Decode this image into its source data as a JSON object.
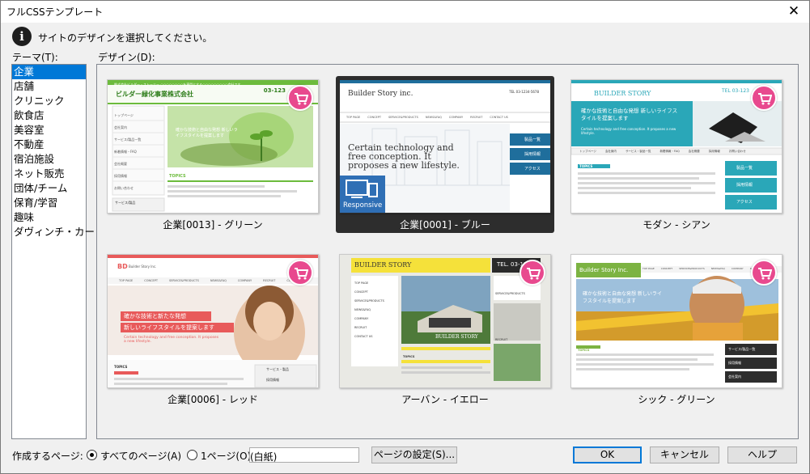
{
  "window": {
    "title": "フルCSSテンプレート"
  },
  "info": {
    "message": "サイトのデザインを選択してください。"
  },
  "labels": {
    "theme": "テーマ(T):",
    "design": "デザイン(D):"
  },
  "themes": [
    {
      "label": "企業",
      "selected": true
    },
    {
      "label": "店舗"
    },
    {
      "label": "クリニック"
    },
    {
      "label": "飲食店"
    },
    {
      "label": "美容室"
    },
    {
      "label": "不動産"
    },
    {
      "label": "宿泊施設"
    },
    {
      "label": "ネット販売"
    },
    {
      "label": "団体/チーム"
    },
    {
      "label": "保育/学習"
    },
    {
      "label": "趣味"
    },
    {
      "label": "ダヴィンチ・カート"
    }
  ],
  "designs": [
    {
      "caption": "企業[0013] - グリーン",
      "thumb": {
        "header": "株式会社ビルダー・ストーリー ○○○○○○○○を専門とする○○○○○○○○○会社です。",
        "logo": "ビルダー緑化事業株式会社",
        "tel": "03-123",
        "nav": [
          "トップページ",
          "会社案内",
          "サービス/製品一覧",
          "新着情報・FAQ",
          "会社概要",
          "採用情報",
          "お問い合わせ"
        ],
        "hero_text": "確かな技術と自由な発想 新しいライフスタイルを提案します",
        "section": "TOPICS",
        "side": [
          "サービス/製品",
          "採用情報"
        ]
      }
    },
    {
      "caption": "企業[0001] - ブルー",
      "selected": true,
      "thumb": {
        "logo": "Builder Story inc.",
        "tel": "TEL 03-1234-5678",
        "nav": [
          "TOP PAGE",
          "CONCEPT",
          "SERVICE&PRODUCTS",
          "NEWS&FAQ",
          "COMPANY",
          "RECRUIT",
          "CONTACT US"
        ],
        "hero_text": "Certain technology and free conception. It proposes a new lifestyle.",
        "side": [
          "製品一覧",
          "採用情報",
          "アクセス"
        ],
        "badge": "Responsive"
      }
    },
    {
      "caption": "モダン - シアン",
      "thumb": {
        "logo": "BUILDER STORY",
        "tel": "TEL 03-123",
        "hero_jp": "確かな技術と自由な発想 新しいライフスタイルを提案します",
        "hero_en": "Certain technology and free conception. It proposes a new lifestyle.",
        "nav": [
          "トップページ",
          "会社案内",
          "サービス・製品一覧",
          "新着情報・FAQ",
          "会社概要",
          "採用情報",
          "お問い合わせ"
        ],
        "section": "TOPICS",
        "side": [
          "製品一覧",
          "採用情報",
          "アクセス"
        ]
      }
    },
    {
      "caption": "企業[0006] - レッド",
      "thumb": {
        "logo": "BD",
        "logo_sub": "Builder Story Inc.",
        "nav": [
          "TOP PAGE",
          "CONCEPT",
          "SERVICE&PRODUCTS",
          "NEWS&FAQ",
          "COMPANY",
          "RECRUIT",
          "CONTACT US"
        ],
        "hero_jp1": "確かな技術と新たな発想",
        "hero_jp2": "新しいライフスタイルを提案します",
        "hero_en": "Certain technology and free conception. It proposes a new lifestyle.",
        "section": "TOPICS",
        "side": [
          "サービス・製品",
          "採用情報"
        ]
      }
    },
    {
      "caption": "アーバン - イエロー",
      "thumb": {
        "logo": "BUILDER STORY",
        "tel": "TEL. 03-1234-",
        "nav": [
          "TOP PAGE",
          "CONCEPT",
          "SERVICE&PRODUCTS",
          "NEWS&FAQ",
          "COMPANY",
          "RECRUIT",
          "CONTACT US"
        ],
        "photo_label": "BUILDER STORY",
        "side": [
          "SERVICE&PRODUCTS",
          "RECRUIT"
        ],
        "section": "TOPICS"
      }
    },
    {
      "caption": "シック - グリーン",
      "thumb": {
        "logo": "Builder Story Inc.",
        "nav": [
          "TOP PAGE",
          "CONCEPT",
          "SERVICE&PRODUCTS",
          "NEWS&FAQ",
          "COMPANY",
          "RECRUIT"
        ],
        "hero_text": "確かな技術と自由な発想 新しいライフスタイルを提案します",
        "section": "TOPICS",
        "side": [
          "サービス/製品一覧",
          "採用情報",
          "会社案内"
        ]
      }
    }
  ],
  "bottom": {
    "pages_label": "作成するページ:",
    "radio_all": "すべてのページ(A)",
    "radio_one": "1ページ(O)",
    "paper_value": "(白紙)",
    "page_settings": "ページの設定(S)...",
    "ok": "OK",
    "cancel": "キャンセル",
    "help": "ヘルプ"
  },
  "colors": {
    "selection": "#0078d7",
    "cart_badge": "#e8498e",
    "green": "#6cbb3c",
    "blue": "#1f6e9c",
    "cyan": "#2aa7b8",
    "red": "#e85a5a",
    "yellow": "#f5e13a"
  }
}
